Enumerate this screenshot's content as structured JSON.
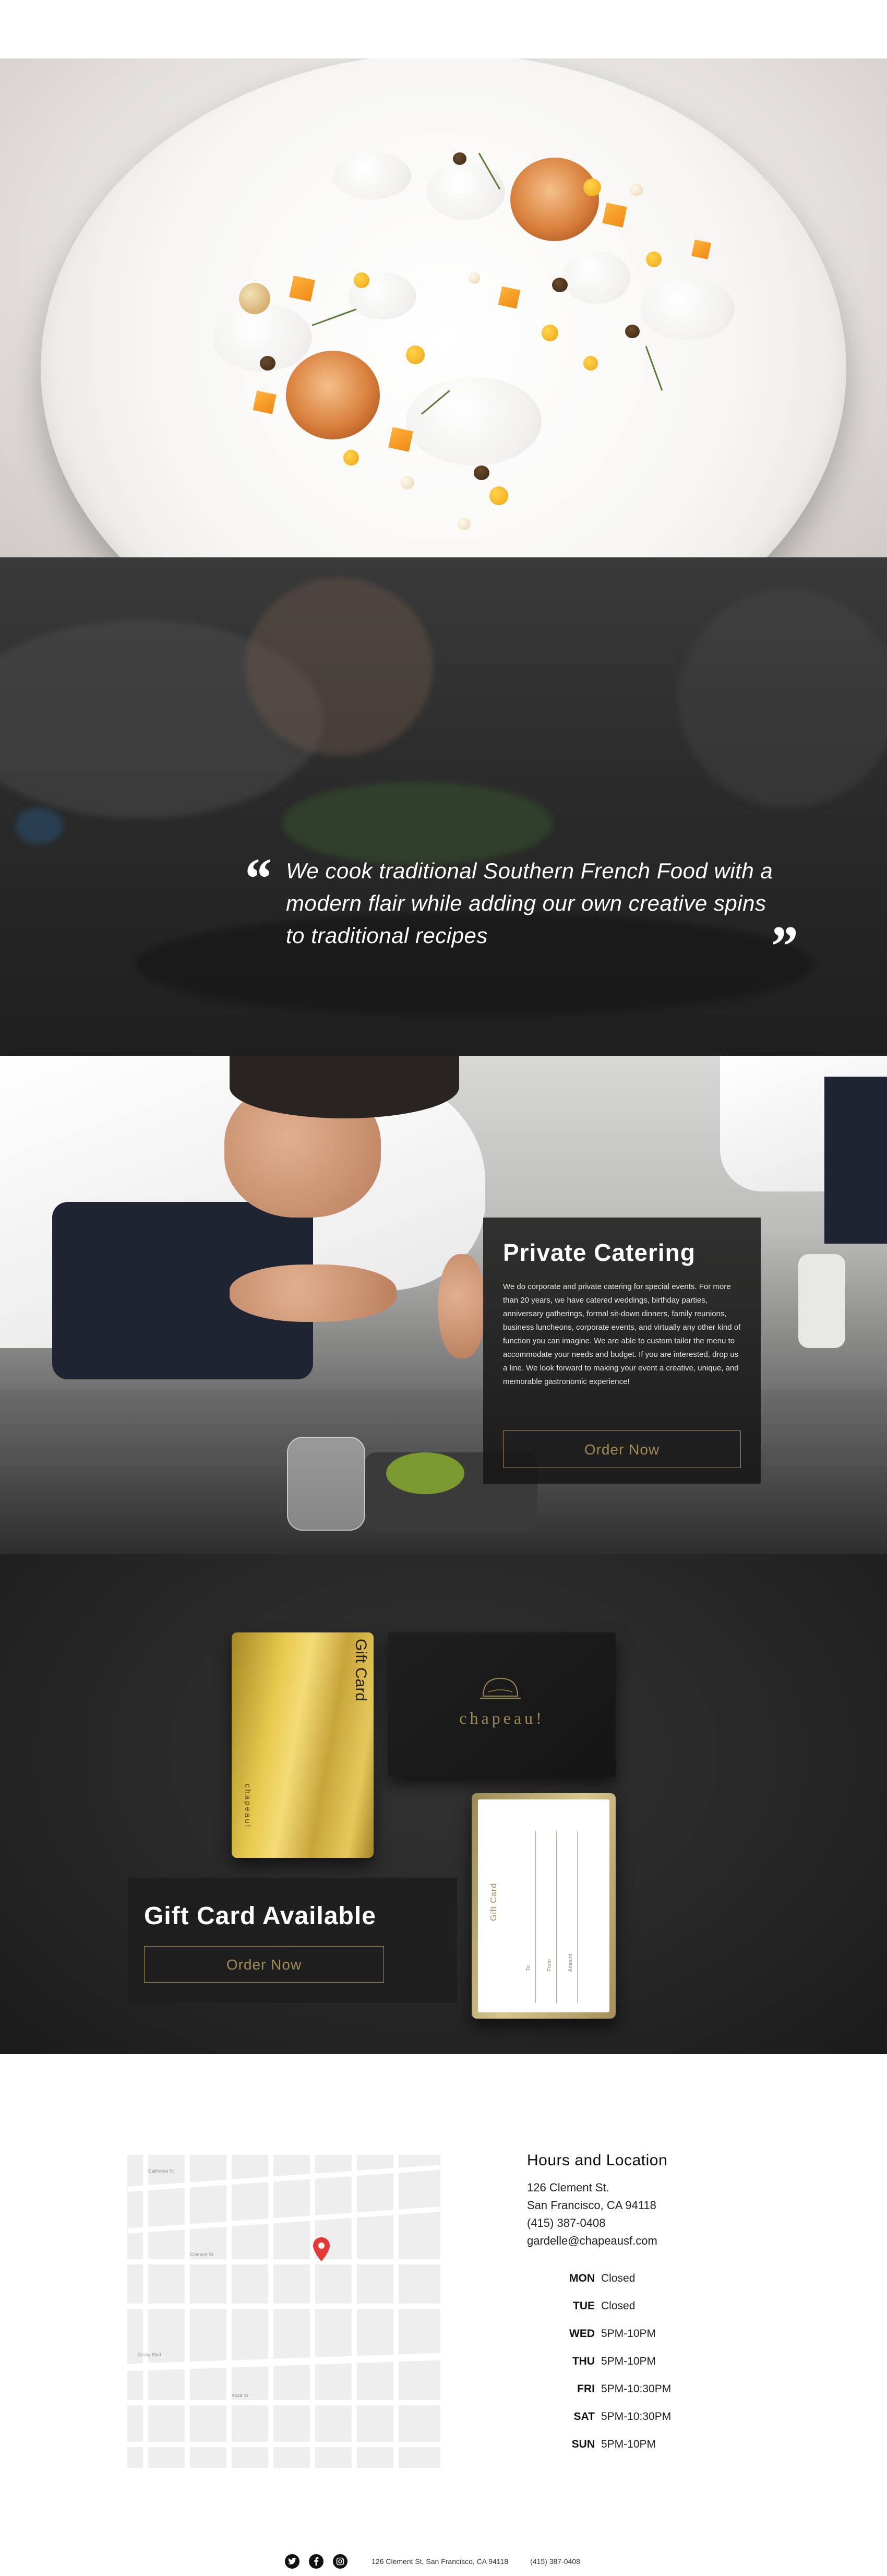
{
  "quote": {
    "open_mark": "“",
    "close_mark": "”",
    "text": "We cook traditional Southern French Food with a modern flair while adding our own creative spins to traditional recipes"
  },
  "catering": {
    "title": "Private Catering",
    "body": "We do corporate and private catering for special events. For more than 20 years, we have catered weddings, birthday parties, anniversary gatherings, formal sit-down dinners, family reunions, business luncheons, corporate events, and virtually any other kind of function you can imagine. We are able to custom tailor the menu to accommodate your needs and budget. If you are interested, drop us a line. We look forward to making your event a creative, unique, and memorable gastronomic experience!",
    "button_label": "Order Now"
  },
  "gift": {
    "gold_card_label": "Gift Card",
    "gold_card_brand": "chapeau!",
    "sleeve_brand": "chapeau!",
    "white_card_label": "Gift Card",
    "white_card_fields": [
      "To",
      "From",
      "Amount"
    ],
    "title": "Gift Card Available",
    "button_label": "Order Now"
  },
  "location": {
    "title": "Hours and Location",
    "address_line1": "126 Clement St.",
    "address_line2": "San Francisco, CA 94118",
    "phone": "(415) 387-0408",
    "email": "gardelle@chapeausf.com",
    "hours": [
      {
        "day": "MON",
        "time": "Closed"
      },
      {
        "day": "TUE",
        "time": "Closed"
      },
      {
        "day": "WED",
        "time": "5PM-10PM"
      },
      {
        "day": "THU",
        "time": "5PM-10PM"
      },
      {
        "day": "FRI",
        "time": "5PM-10:30PM"
      },
      {
        "day": "SAT",
        "time": "5PM-10:30PM"
      },
      {
        "day": "SUN",
        "time": "5PM-10PM"
      }
    ],
    "map_labels": [
      "California St",
      "Clement St",
      "Geary Blvd",
      "Anza St"
    ]
  },
  "footer": {
    "social_icons": [
      "twitter-icon",
      "facebook-icon",
      "instagram-icon"
    ],
    "address": "126 Clement St, San Francisco, CA 94118",
    "phone": "(415) 387-0408"
  },
  "colors": {
    "gold_accent": "#a08a55",
    "dark_panel": "#141414",
    "map_pin": "#e53935"
  }
}
